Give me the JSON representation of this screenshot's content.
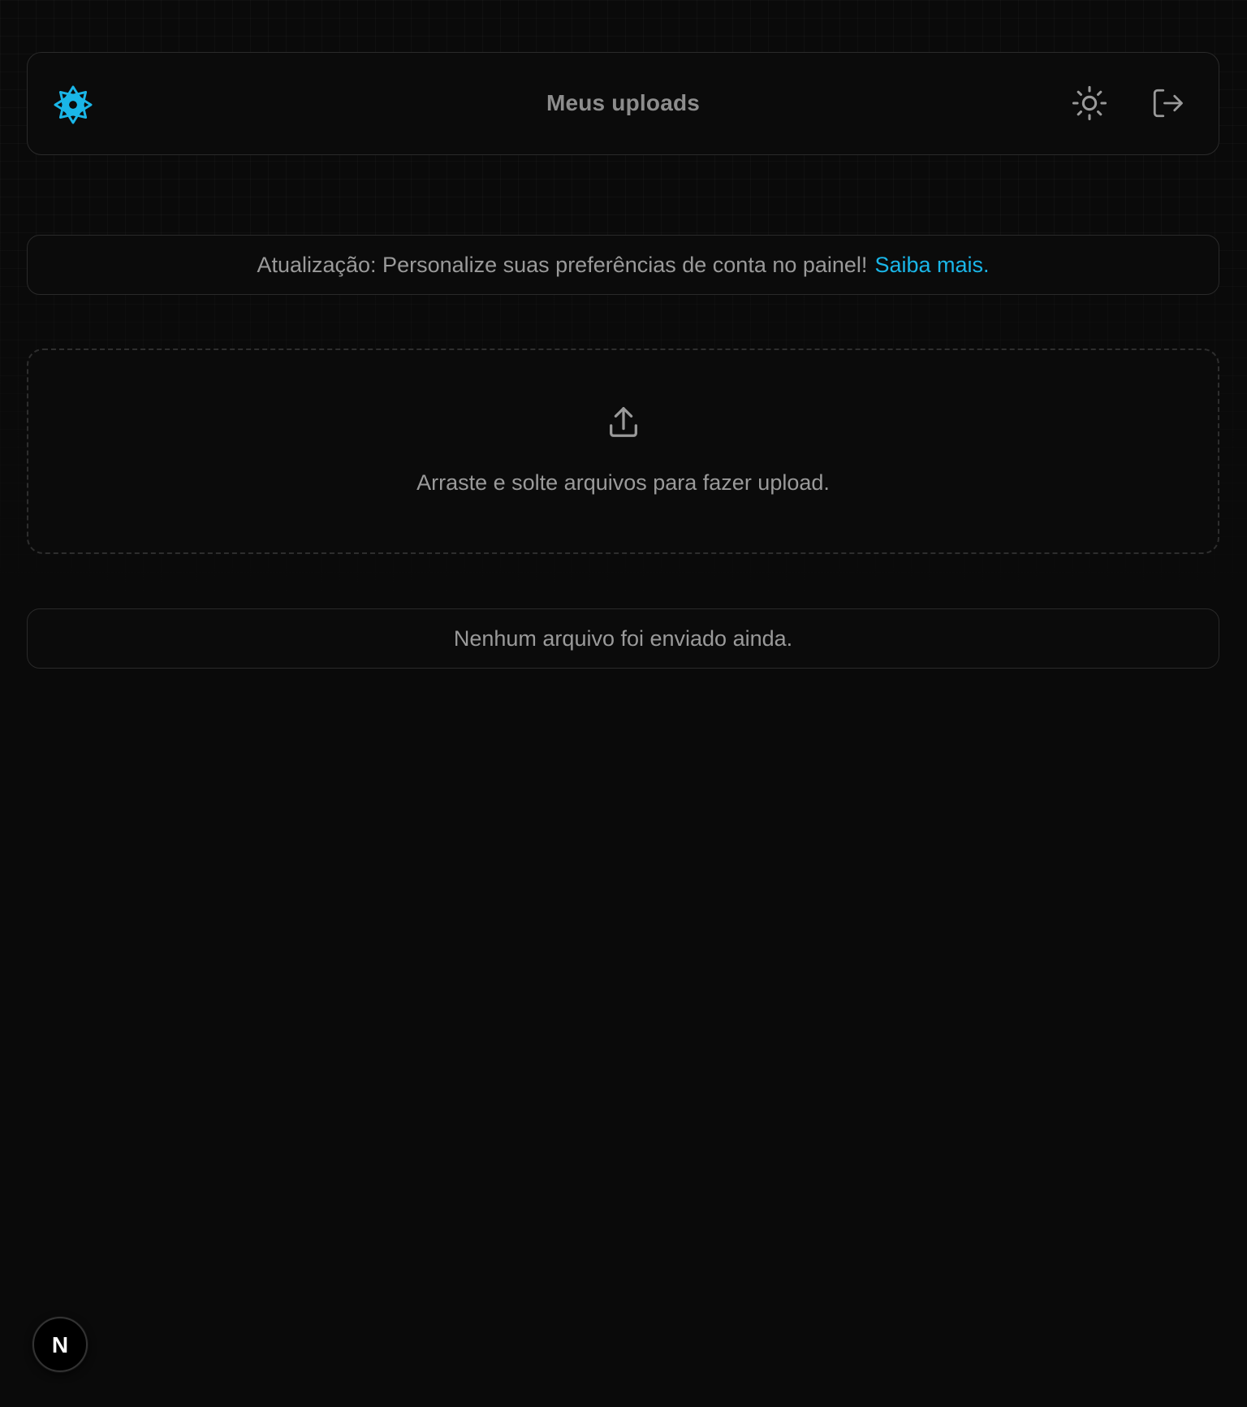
{
  "header": {
    "title": "Meus uploads",
    "logo_icon": "snowflake-gear-logo-icon",
    "theme_toggle_icon": "sun-icon",
    "logout_icon": "logout-icon"
  },
  "banner": {
    "text": "Atualização: Personalize suas preferências de conta no painel!",
    "link_label": "Saiba mais."
  },
  "dropzone": {
    "icon": "upload-icon",
    "text": "Arraste e solte arquivos para fazer upload."
  },
  "file_list": {
    "empty_text": "Nenhum arquivo foi enviado ainda."
  },
  "dev_badge": {
    "label": "N"
  },
  "colors": {
    "background": "#0a0a0a",
    "accent": "#1ab6e8",
    "border": "#2a2a2a",
    "text_muted": "#9a9a9a"
  }
}
